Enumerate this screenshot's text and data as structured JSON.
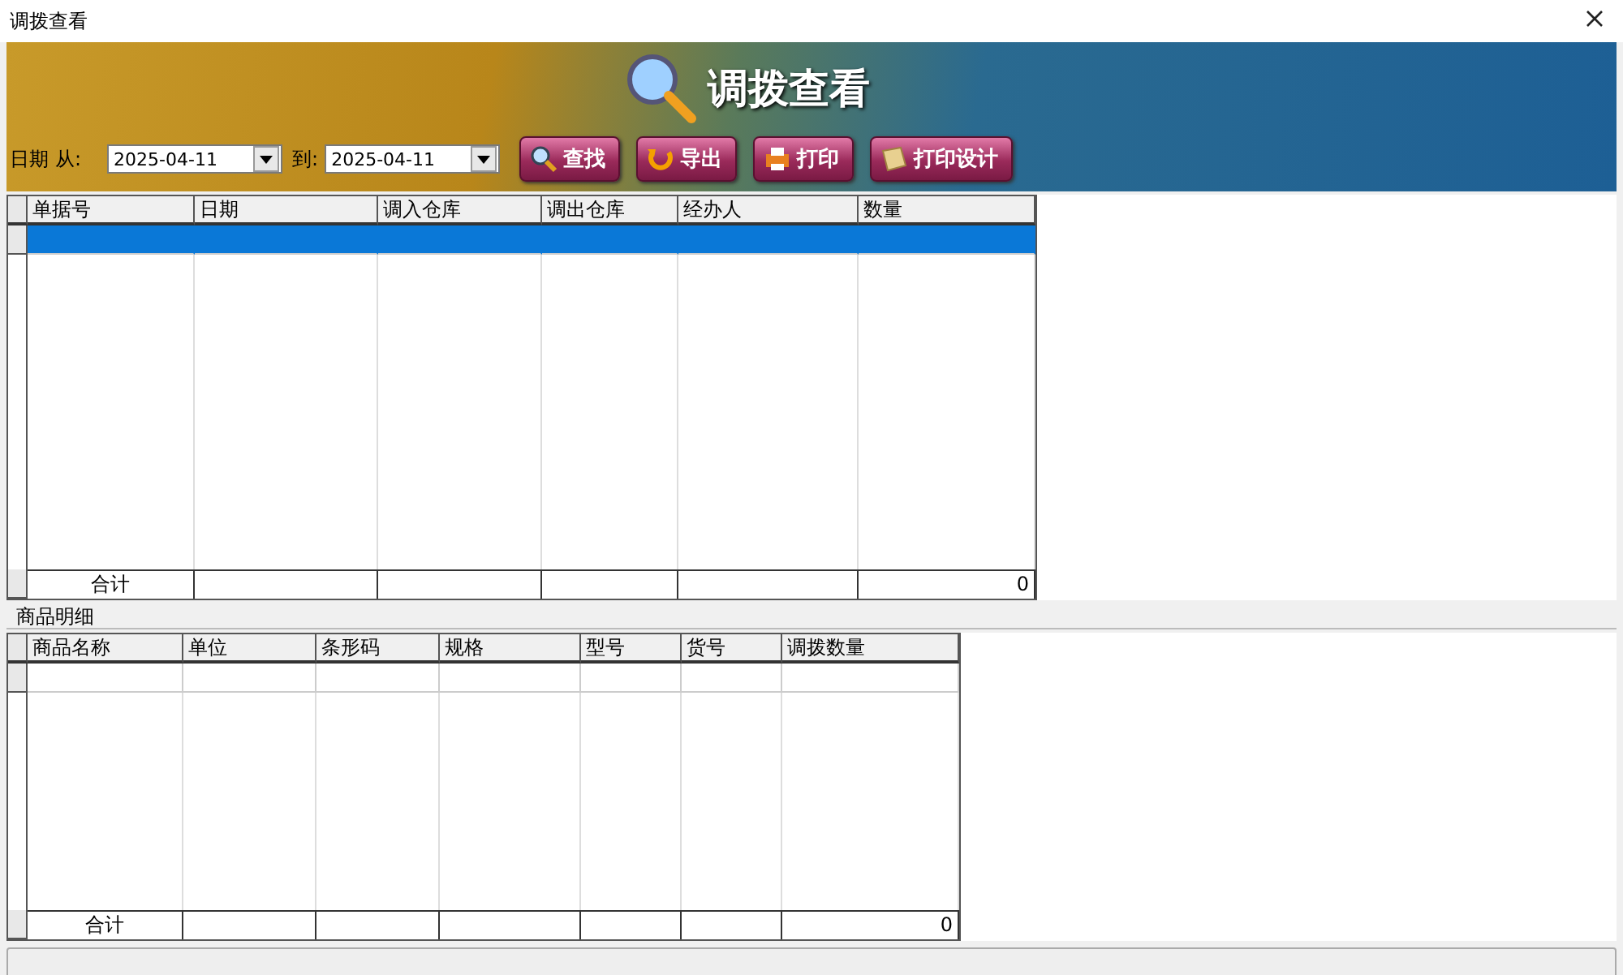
{
  "window": {
    "title": "调拨查看"
  },
  "banner": {
    "title": "调拨查看"
  },
  "filter": {
    "label": "日期",
    "from_label": "从:",
    "from_value": "2025-04-11",
    "to_label": "到:",
    "to_value": "2025-04-11"
  },
  "buttons": [
    {
      "kind": "search",
      "label": "查找"
    },
    {
      "kind": "export",
      "label": "导出"
    },
    {
      "kind": "print",
      "label": "打印"
    },
    {
      "kind": "design",
      "label": "打印设计"
    }
  ],
  "transfer_table": {
    "columns": [
      "单据号",
      "日期",
      "调入仓库",
      "调出仓库",
      "经办人",
      "数量"
    ],
    "rows": [
      {
        "selected": true
      }
    ],
    "footer": {
      "label": "合计",
      "total": "0"
    }
  },
  "detail_section": {
    "title": "商品明细"
  },
  "detail_table": {
    "columns": [
      "商品名称",
      "单位",
      "条形码",
      "规格",
      "型号",
      "货号",
      "调拨数量"
    ],
    "rows": [
      {
        "selected": false
      }
    ],
    "footer": {
      "label": "合计",
      "total": "0"
    }
  }
}
